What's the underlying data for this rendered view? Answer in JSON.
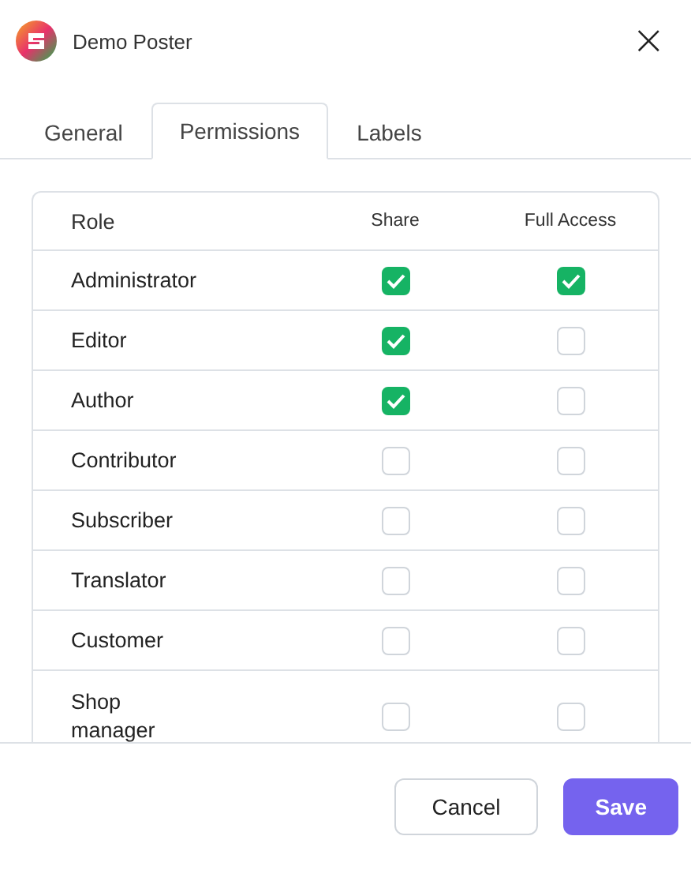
{
  "window": {
    "title": "Demo Poster",
    "close": "×"
  },
  "tabs": [
    {
      "label": "General",
      "selected": false
    },
    {
      "label": "Permissions",
      "selected": true
    },
    {
      "label": "Labels",
      "selected": false
    }
  ],
  "table": {
    "columns": [
      "Role",
      "Share",
      "Full Access"
    ],
    "rows": [
      {
        "role": "Administrator",
        "share": true,
        "full_access": true
      },
      {
        "role": "Editor",
        "share": true,
        "full_access": false
      },
      {
        "role": "Author",
        "share": true,
        "full_access": false
      },
      {
        "role": "Contributor",
        "share": false,
        "full_access": false
      },
      {
        "role": "Subscriber",
        "share": false,
        "full_access": false
      },
      {
        "role": "Translator",
        "share": false,
        "full_access": false
      },
      {
        "role": "Customer",
        "share": false,
        "full_access": false
      },
      {
        "role": "Shop manager",
        "share": false,
        "full_access": false
      }
    ]
  },
  "buttons": [
    {
      "label": "Cancel",
      "kind": "secondary"
    },
    {
      "label": "Save",
      "kind": "primary"
    }
  ]
}
